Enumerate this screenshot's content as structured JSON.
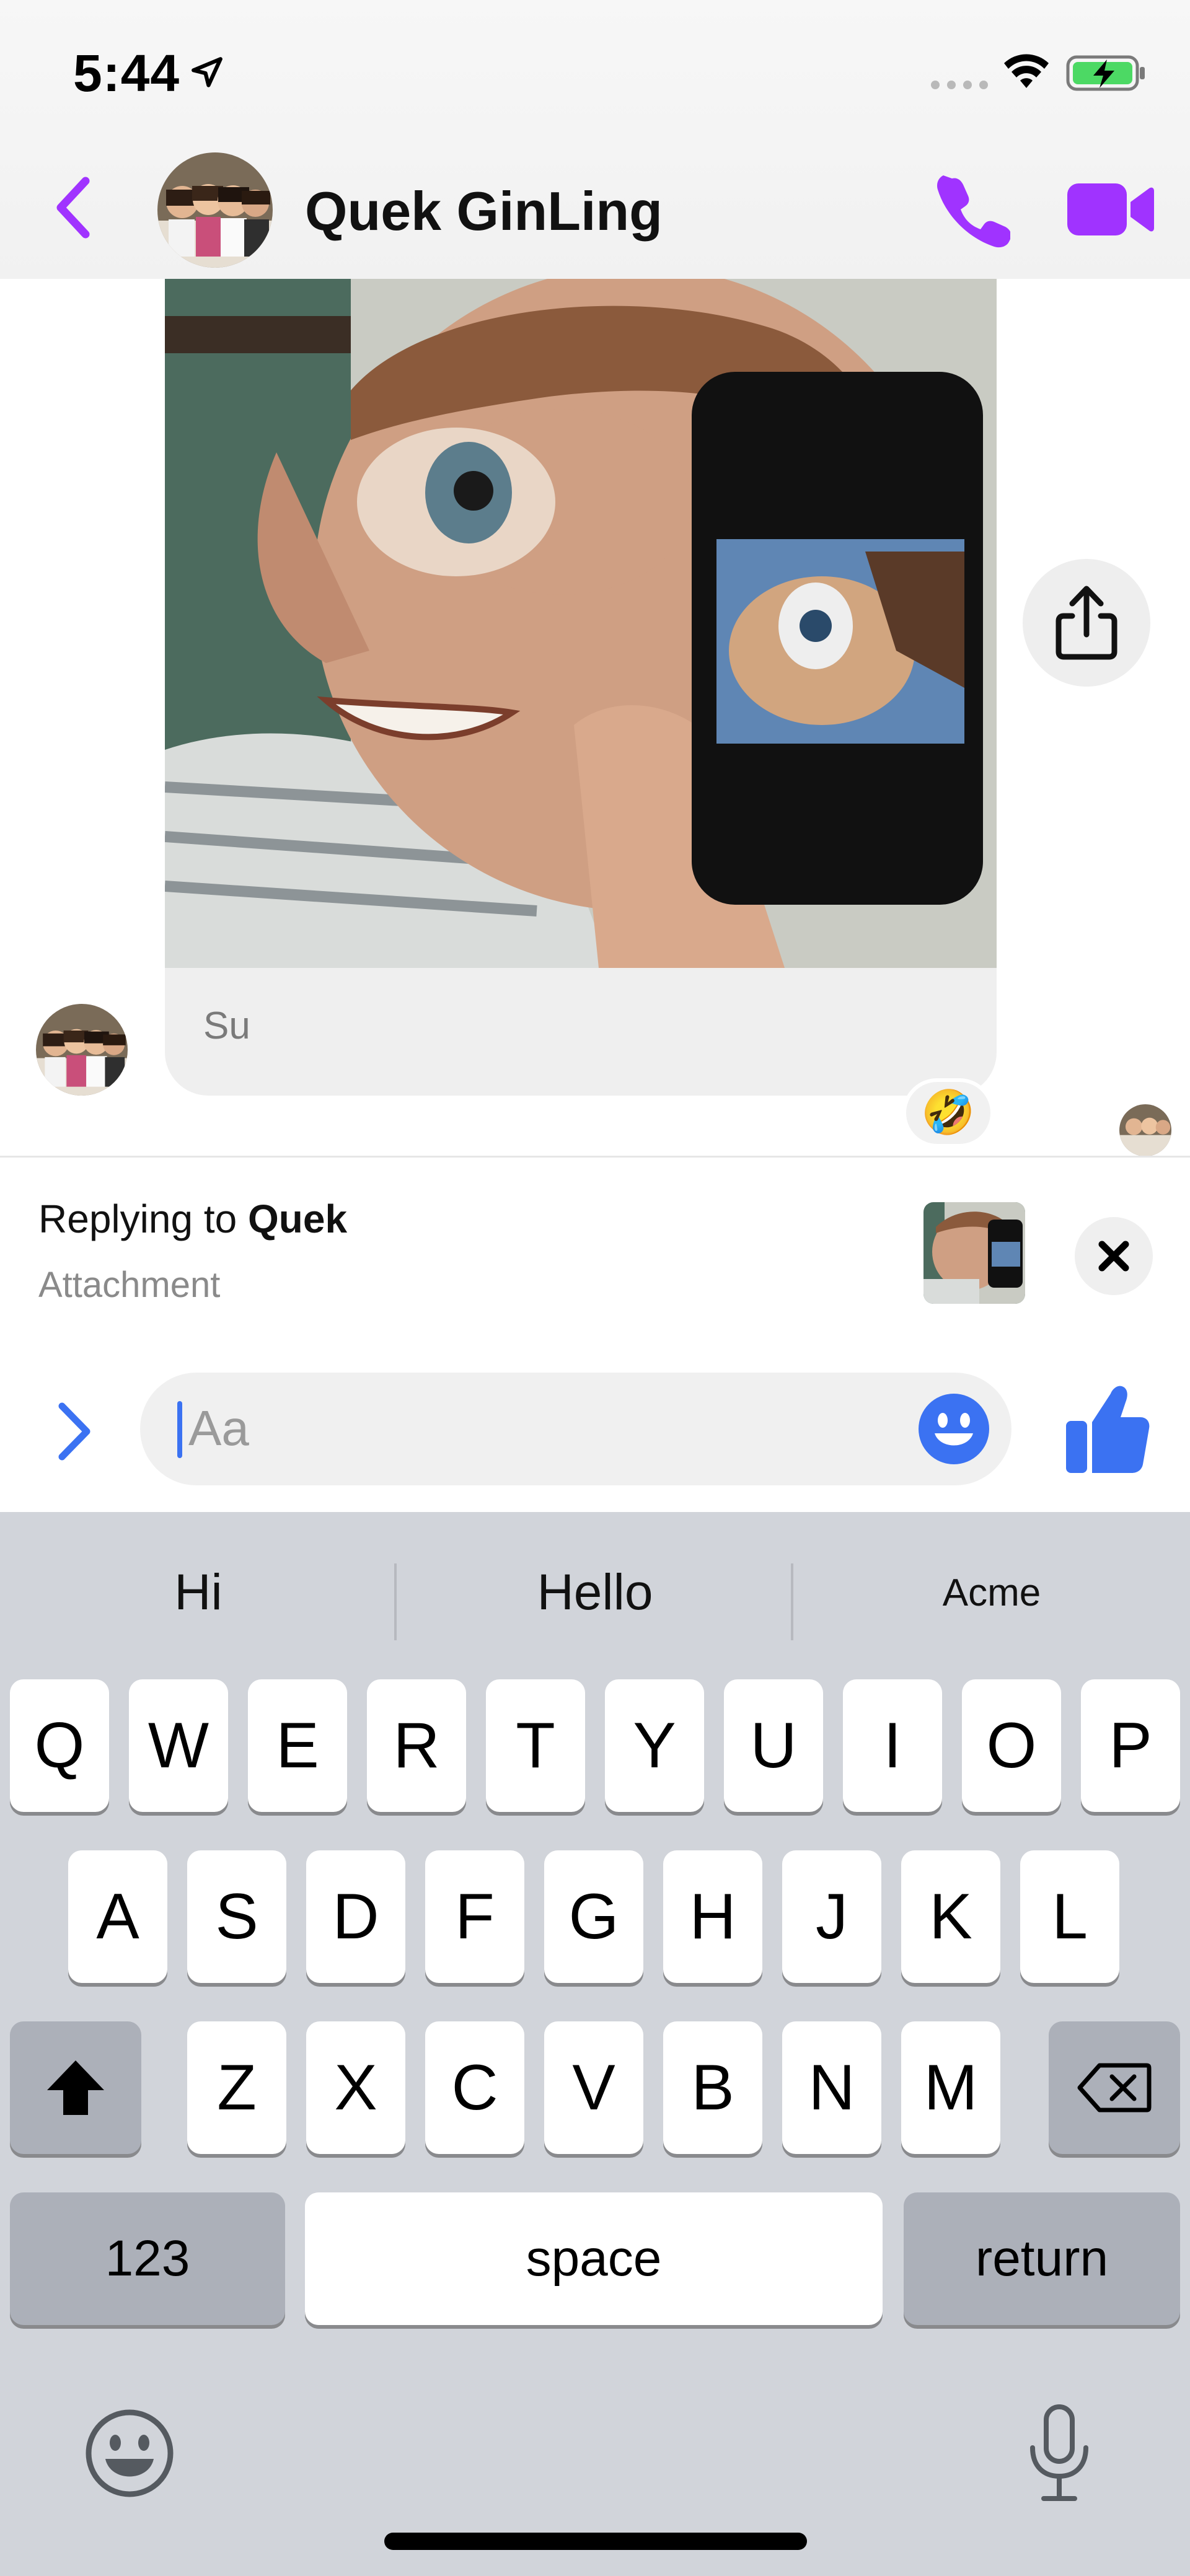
{
  "status_bar": {
    "time": "5:44"
  },
  "header": {
    "contact_name": "Quek GinLing"
  },
  "conversation": {
    "caption": "Su",
    "reaction_emoji": "🤣"
  },
  "reply": {
    "prefix": "Replying to ",
    "name": "Quek",
    "subtitle": "Attachment"
  },
  "composer": {
    "placeholder": "Aa"
  },
  "keyboard": {
    "suggestions": [
      "Hi",
      "Hello",
      "Acme"
    ],
    "row1": [
      "Q",
      "W",
      "E",
      "R",
      "T",
      "Y",
      "U",
      "I",
      "O",
      "P"
    ],
    "row2": [
      "A",
      "S",
      "D",
      "F",
      "G",
      "H",
      "J",
      "K",
      "L"
    ],
    "row3": [
      "Z",
      "X",
      "C",
      "V",
      "B",
      "N",
      "M"
    ],
    "numbers_label": "123",
    "space_label": "space",
    "return_label": "return"
  },
  "colors": {
    "accent_purple": "#a033ff",
    "messenger_blue": "#3b72f2",
    "battery_green": "#4cd964"
  },
  "icons": [
    "location-arrow-icon",
    "signal-icon",
    "wifi-icon",
    "battery-icon",
    "back-chevron-icon",
    "phone-icon",
    "video-camera-icon",
    "share-icon",
    "close-icon",
    "expand-chevron-icon",
    "smiley-icon",
    "thumbs-up-icon",
    "shift-icon",
    "backspace-icon",
    "keyboard-emoji-icon",
    "microphone-icon"
  ]
}
